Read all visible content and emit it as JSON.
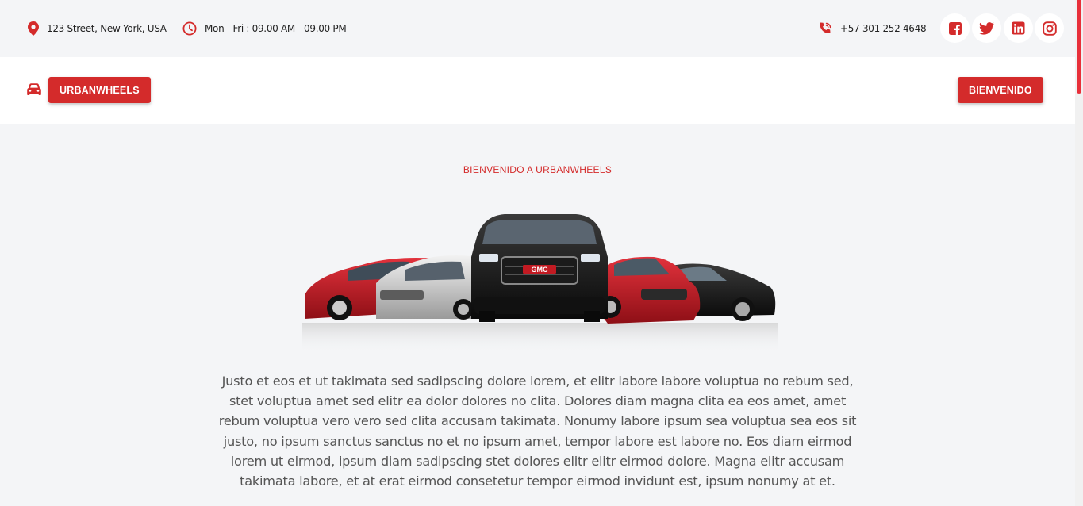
{
  "topbar": {
    "address": "123 Street, New York, USA",
    "hours": "Mon - Fri : 09.00 AM - 09.00 PM",
    "phone": "+57 301 252 4648",
    "socials": [
      {
        "name": "facebook",
        "icon": "facebook-icon"
      },
      {
        "name": "twitter",
        "icon": "twitter-icon"
      },
      {
        "name": "linkedin",
        "icon": "linkedin-icon"
      },
      {
        "name": "instagram",
        "icon": "instagram-icon"
      }
    ]
  },
  "navbar": {
    "car_icon": "car-icon",
    "brand_button": "URBANWHEELS",
    "welcome_button": "BIENVENIDO"
  },
  "main": {
    "kicker": "BIENVENIDO A URBANWHEELS",
    "paragraph": "Justo et eos et ut takimata sed sadipscing dolore lorem, et elitr labore labore voluptua no rebum sed, stet voluptua amet sed elitr ea dolor dolores no clita. Dolores diam magna clita ea eos amet, amet rebum voluptua vero vero sed clita accusam takimata. Nonumy labore ipsum sea voluptua sea eos sit justo, no ipsum sanctus sanctus no et no ipsum amet, tempor labore est labore no. Eos diam eirmod lorem ut eirmod, ipsum diam sadipscing stet dolores elitr elitr eirmod dolore. Magna elitr accusam takimata labore, et at erat eirmod consetetur tempor eirmod invidunt est, ipsum nonumy at et.",
    "hero_emblem": "GMC"
  },
  "colors": {
    "accent": "#D42B2B",
    "background": "#F4F5F7",
    "scroll_thumb": "#E8303A"
  }
}
